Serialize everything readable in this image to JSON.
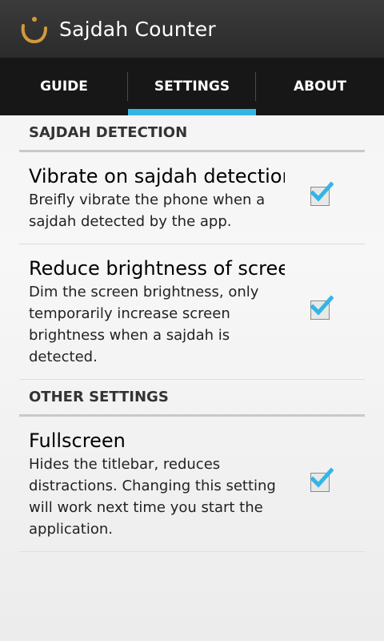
{
  "app": {
    "title": "Sajdah Counter",
    "icon": "nun-letter-icon",
    "icon_color": "#d39a3a"
  },
  "tabs": [
    {
      "label": "GUIDE",
      "selected": false
    },
    {
      "label": "SETTINGS",
      "selected": true
    },
    {
      "label": "ABOUT",
      "selected": false
    }
  ],
  "colors": {
    "accent": "#33b5e5",
    "check": "#33b5e5"
  },
  "sections": [
    {
      "header": "SAJDAH DETECTION",
      "prefs": [
        {
          "title": "Vibrate on sajdah detection",
          "summary": "Breifly vibrate the phone when a sajdah detected by the app.",
          "checked": true
        },
        {
          "title": "Reduce brightness of screen",
          "summary": "Dim the screen brightness, only temporarily increase screen brightness when a sajdah is detected.",
          "checked": true
        }
      ]
    },
    {
      "header": "OTHER SETTINGS",
      "prefs": [
        {
          "title": "Fullscreen",
          "summary": "Hides the titlebar, reduces distractions. Changing this setting will work next time you start the application.",
          "checked": true
        }
      ]
    }
  ]
}
